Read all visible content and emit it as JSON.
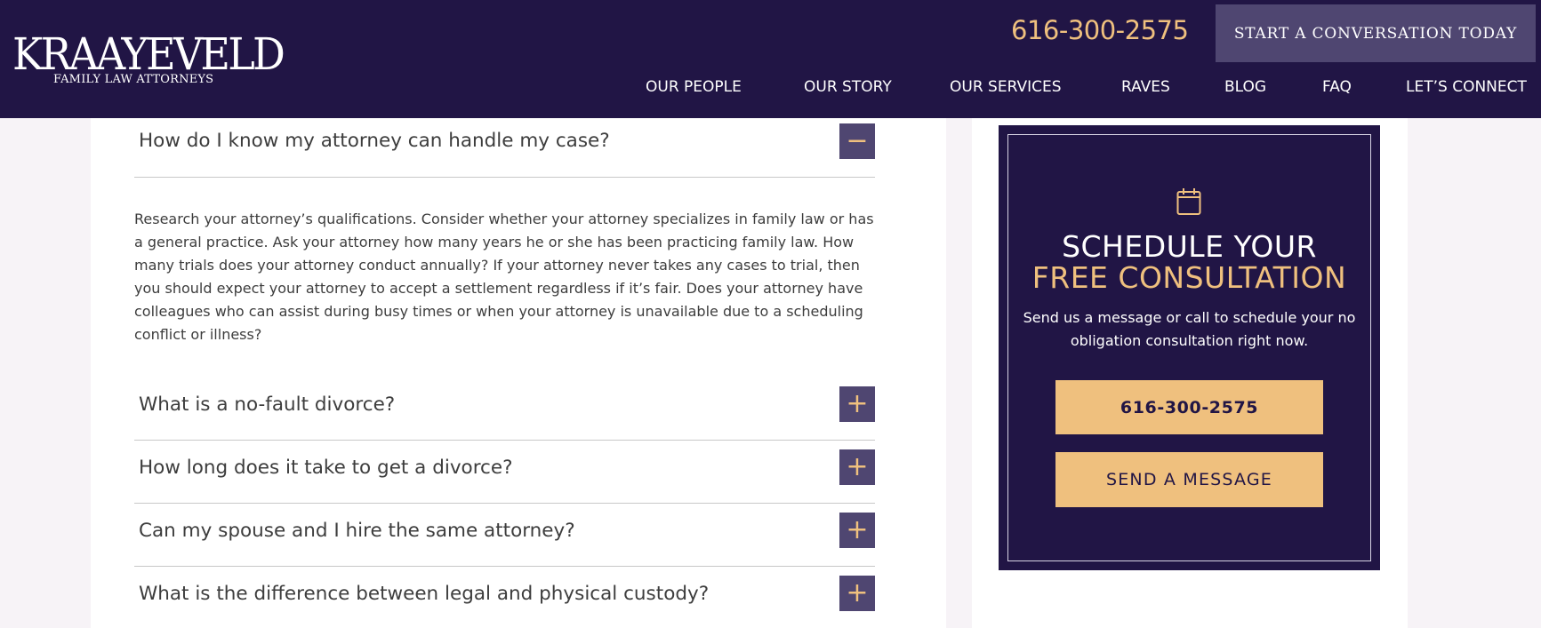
{
  "header": {
    "logo_main": "KRAAYEVELD",
    "logo_sub": "FAMILY LAW ATTORNEYS",
    "phone": "616-300-2575",
    "cta_label": "START A CONVERSATION TODAY",
    "nav": [
      "OUR PEOPLE",
      "OUR STORY",
      "OUR SERVICES",
      "RAVES",
      "BLOG",
      "FAQ",
      "LET’S CONNECT"
    ]
  },
  "faq": {
    "open_question": "How do I know my attorney can handle my case?",
    "open_answer": "Research your attorney’s qualifications.  Consider whether your attorney specializes in family law or has a general practice.  Ask your attorney how many years he or she has been practicing family law.  How many trials does your attorney conduct annually? If your attorney never takes any cases to trial, then you should expect your attorney to accept a settlement regardless if it’s fair. Does your attorney have colleagues who can assist during busy times or when your attorney is unavailable due to a scheduling conflict or illness?",
    "collapse_symbol": "−",
    "expand_symbol": "+",
    "questions": [
      "What is a no-fault divorce?",
      "How long does it take to get a divorce?",
      "Can my spouse and I hire the same attorney?",
      "What is the difference between legal and physical custody?"
    ]
  },
  "sidebar": {
    "icon": "calendar-icon",
    "title_line1": "SCHEDULE YOUR",
    "title_line2": "FREE CONSULTATION",
    "text": "Send us a message or call to schedule your no obligation consultation right now.",
    "phone_button": "616-300-2575",
    "message_button": "SEND A MESSAGE"
  },
  "colors": {
    "navy": "#211545",
    "gold": "#efc07e",
    "button_purple": "#4f4671"
  }
}
